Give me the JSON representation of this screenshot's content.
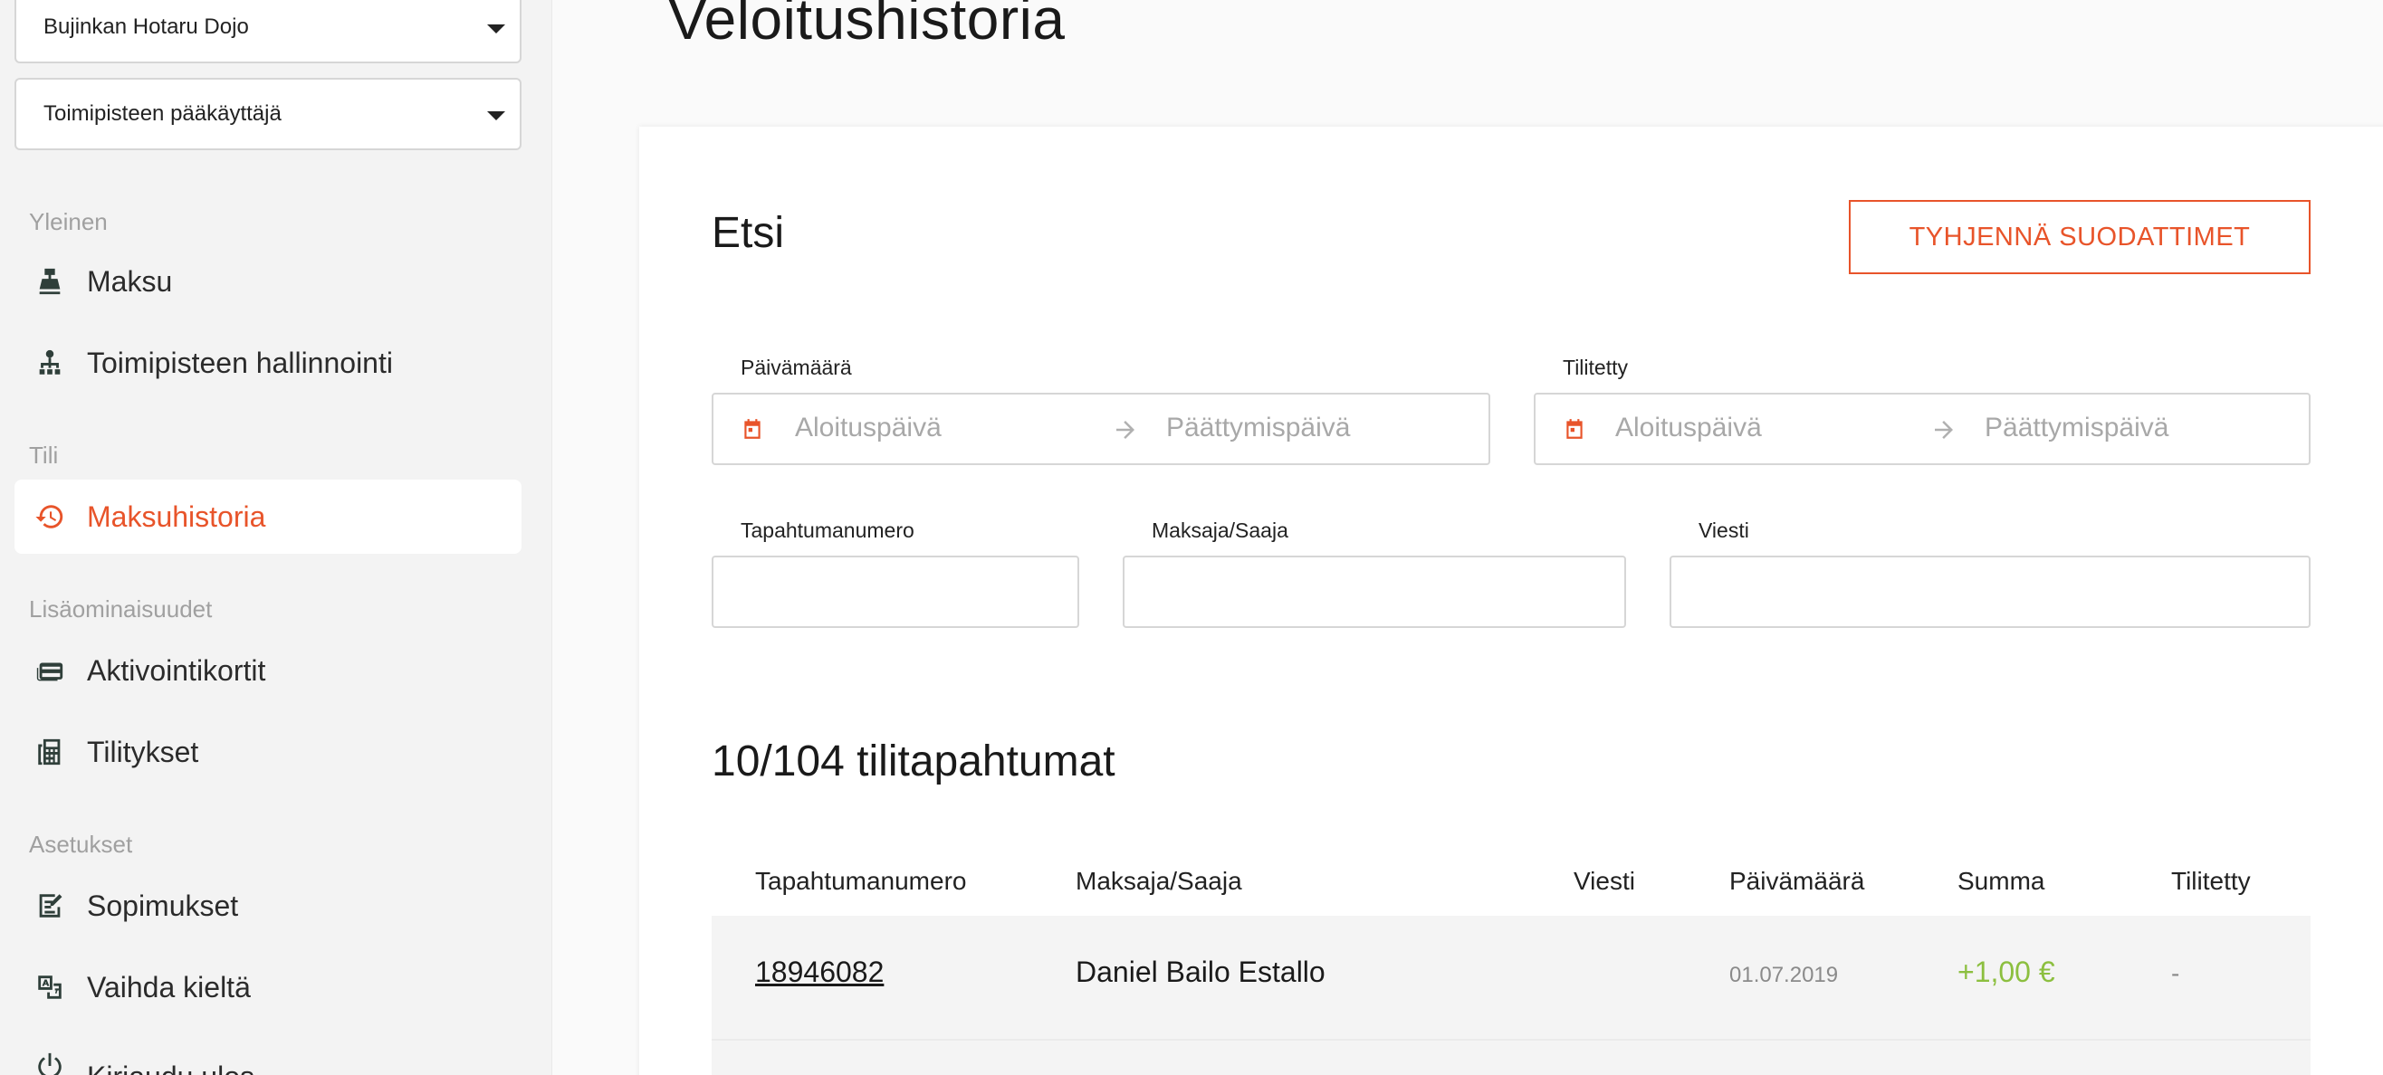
{
  "sidebar": {
    "dojo_select": "Bujinkan Hotaru Dojo",
    "role_select": "Toimipisteen pääkäyttäjä",
    "sections": {
      "general": "Yleinen",
      "account": "Tili",
      "extras": "Lisäominaisuudet",
      "settings": "Asetukset"
    },
    "items": {
      "payment": "Maksu",
      "site_admin": "Toimipisteen hallinnointi",
      "payment_history": "Maksuhistoria",
      "activation_cards": "Aktivointikortit",
      "settlements": "Tilitykset",
      "agreements": "Sopimukset",
      "change_language": "Vaihda kieltä",
      "logout": "Kirjaudu ulos"
    }
  },
  "page": {
    "title": "Veloitushistoria"
  },
  "search": {
    "title": "Etsi",
    "clear_button": "TYHJENNÄ SUODATTIMET",
    "date_label": "Päivämäärä",
    "settled_label": "Tilitetty",
    "start_placeholder": "Aloituspäivä",
    "end_placeholder": "Päättymispäivä",
    "transaction_label": "Tapahtumanumero",
    "payer_label": "Maksaja/Saaja",
    "message_label": "Viesti",
    "transaction_value": "",
    "payer_value": "",
    "message_value": ""
  },
  "results": {
    "title": "10/104 tilitapahtumat",
    "columns": [
      "Tapahtumanumero",
      "Maksaja/Saaja",
      "Viesti",
      "Päivämäärä",
      "Summa",
      "Tilitetty"
    ],
    "rows": [
      {
        "id": "18946082",
        "payer": "Daniel Bailo Estallo",
        "message": "",
        "date": "01.07.2019",
        "sum": "+1,00 €",
        "settled": "-"
      }
    ]
  },
  "colors": {
    "accent": "#e8542a",
    "positive": "#8cbf3f",
    "sidebar_bg": "#f3f3f3"
  },
  "icons": {
    "payment": "cash-register-icon",
    "site_admin": "sitemap-icon",
    "payment_history": "history-icon",
    "activation_cards": "card-icon",
    "settlements": "calculator-icon",
    "agreements": "edit-document-icon",
    "change_language": "translate-icon",
    "logout": "power-icon"
  }
}
